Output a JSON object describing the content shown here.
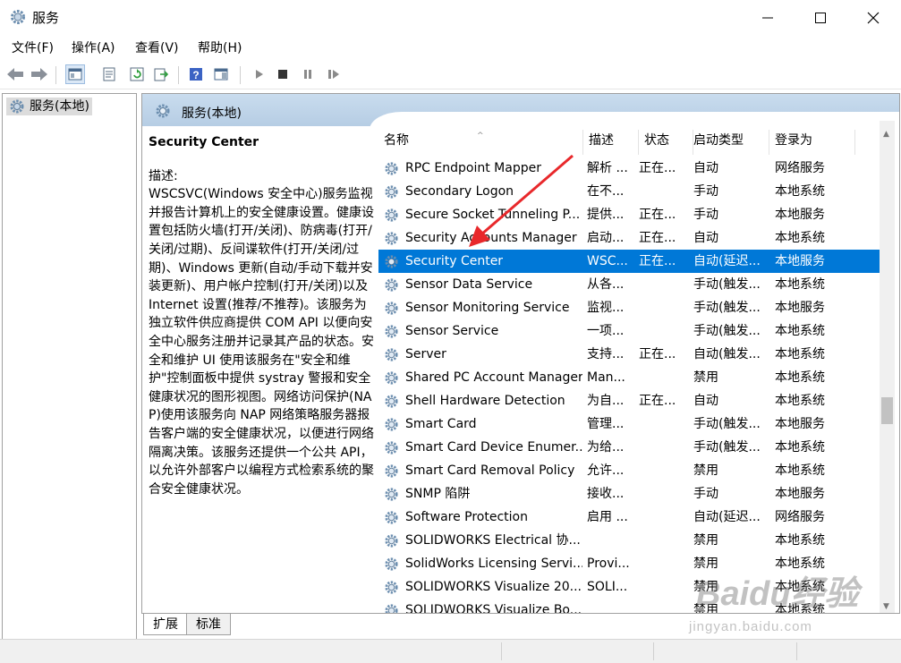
{
  "window": {
    "title": "服务"
  },
  "menu": {
    "items": [
      "文件(F)",
      "操作(A)",
      "查看(V)",
      "帮助(H)"
    ]
  },
  "tree": {
    "root_label": "服务(本地)"
  },
  "main": {
    "header_title": "服务(本地)"
  },
  "description": {
    "service_name": "Security Center",
    "label": "描述:",
    "text": "WSCSVC(Windows 安全中心)服务监视并报告计算机上的安全健康设置。健康设置包括防火墙(打开/关闭)、防病毒(打开/关闭/过期)、反间谍软件(打开/关闭/过期)、Windows 更新(自动/手动下载并安装更新)、用户帐户控制(打开/关闭)以及 Internet 设置(推荐/不推荐)。该服务为独立软件供应商提供 COM API 以便向安全中心服务注册并记录其产品的状态。安全和维护 UI 使用该服务在\"安全和维护\"控制面板中提供 systray 警报和安全健康状况的图形视图。网络访问保护(NAP)使用该服务向 NAP 网络策略服务器报告客户端的安全健康状况，以便进行网络隔离决策。该服务还提供一个公共 API，以允许外部客户以编程方式检索系统的聚合安全健康状况。"
  },
  "columns": {
    "name": "名称",
    "desc": "描述",
    "status": "状态",
    "startup": "启动类型",
    "logon": "登录为"
  },
  "services": [
    {
      "name": "RPC Endpoint Mapper",
      "desc": "解析 ...",
      "status": "正在...",
      "startup": "自动",
      "logon": "网络服务"
    },
    {
      "name": "Secondary Logon",
      "desc": "在不...",
      "status": "",
      "startup": "手动",
      "logon": "本地系统"
    },
    {
      "name": "Secure Socket Tunneling P...",
      "desc": "提供...",
      "status": "正在...",
      "startup": "手动",
      "logon": "本地服务"
    },
    {
      "name": "Security Accounts Manager",
      "desc": "启动...",
      "status": "正在...",
      "startup": "自动",
      "logon": "本地系统"
    },
    {
      "name": "Security Center",
      "desc": "WSC...",
      "status": "正在...",
      "startup": "自动(延迟...",
      "logon": "本地服务"
    },
    {
      "name": "Sensor Data Service",
      "desc": "从各...",
      "status": "",
      "startup": "手动(触发...",
      "logon": "本地系统"
    },
    {
      "name": "Sensor Monitoring Service",
      "desc": "监视...",
      "status": "",
      "startup": "手动(触发...",
      "logon": "本地服务"
    },
    {
      "name": "Sensor Service",
      "desc": "一项...",
      "status": "",
      "startup": "手动(触发...",
      "logon": "本地系统"
    },
    {
      "name": "Server",
      "desc": "支持...",
      "status": "正在...",
      "startup": "自动(触发...",
      "logon": "本地系统"
    },
    {
      "name": "Shared PC Account Manager",
      "desc": "Man...",
      "status": "",
      "startup": "禁用",
      "logon": "本地系统"
    },
    {
      "name": "Shell Hardware Detection",
      "desc": "为自...",
      "status": "正在...",
      "startup": "自动",
      "logon": "本地系统"
    },
    {
      "name": "Smart Card",
      "desc": "管理...",
      "status": "",
      "startup": "手动(触发...",
      "logon": "本地服务"
    },
    {
      "name": "Smart Card Device Enumer...",
      "desc": "为给...",
      "status": "",
      "startup": "手动(触发...",
      "logon": "本地系统"
    },
    {
      "name": "Smart Card Removal Policy",
      "desc": "允许...",
      "status": "",
      "startup": "禁用",
      "logon": "本地系统"
    },
    {
      "name": "SNMP 陷阱",
      "desc": "接收...",
      "status": "",
      "startup": "手动",
      "logon": "本地服务"
    },
    {
      "name": "Software Protection",
      "desc": "启用 ...",
      "status": "",
      "startup": "自动(延迟...",
      "logon": "网络服务"
    },
    {
      "name": "SOLIDWORKS Electrical 协...",
      "desc": "",
      "status": "",
      "startup": "禁用",
      "logon": "本地系统"
    },
    {
      "name": "SolidWorks Licensing Servi...",
      "desc": "Provi...",
      "status": "",
      "startup": "禁用",
      "logon": "本地系统"
    },
    {
      "name": "SOLIDWORKS Visualize 20...",
      "desc": "SOLI...",
      "status": "",
      "startup": "禁用",
      "logon": "本地系统"
    },
    {
      "name": "SOLIDWORKS Visualize Bo...",
      "desc": "",
      "status": "",
      "startup": "禁用",
      "logon": "本地系统"
    }
  ],
  "selected_index": 4,
  "tabs": [
    "扩展",
    "标准"
  ],
  "watermark": {
    "main": "Baidu经验",
    "sub": "jingyan.baidu.com"
  },
  "colors": {
    "selection": "#0078d7",
    "arrow": "#e8282b",
    "header_band": "#bcd2e8"
  }
}
